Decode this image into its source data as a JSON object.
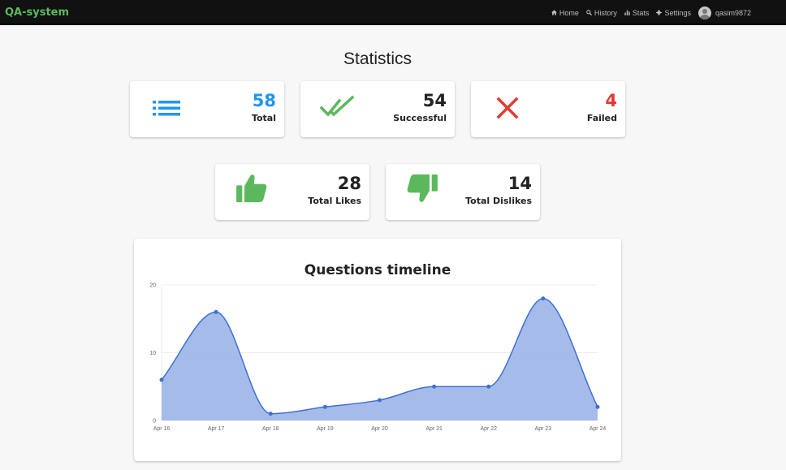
{
  "app": {
    "brand": "QA-system"
  },
  "nav": {
    "home": "Home",
    "history": "History",
    "stats": "Stats",
    "settings": "Settings",
    "username": "qasim9872"
  },
  "page": {
    "title": "Statistics"
  },
  "stats": {
    "total": {
      "value": "58",
      "label": "Total",
      "color": "#2196f3",
      "icon": "list-icon"
    },
    "successful": {
      "value": "54",
      "label": "Successful",
      "color": "#222222",
      "icon": "double-check-icon"
    },
    "failed": {
      "value": "4",
      "label": "Failed",
      "color": "#e53935",
      "icon": "cross-icon"
    },
    "likes": {
      "value": "28",
      "label": "Total Likes",
      "color": "#222222",
      "icon": "thumbs-up-icon"
    },
    "dislikes": {
      "value": "14",
      "label": "Total Dislikes",
      "color": "#222222",
      "icon": "thumbs-down-icon"
    }
  },
  "colors": {
    "success_green": "#5cb85c",
    "fail_red": "#e53935",
    "info_blue": "#2196f3",
    "series_fill": "#a0b8ea",
    "series_line": "#3f6fd1"
  },
  "chart_data": {
    "type": "area",
    "title": "Questions timeline",
    "x": [
      "Apr 16",
      "Apr 17",
      "Apr 18",
      "Apr 19",
      "Apr 20",
      "Apr 21",
      "Apr 22",
      "Apr 23",
      "Apr 24"
    ],
    "values": [
      6,
      16,
      1,
      2,
      3,
      5,
      5,
      18,
      2
    ],
    "ylim": [
      0,
      20
    ],
    "yticks": [
      0,
      10,
      20
    ],
    "grid": true,
    "legend": "none",
    "xlabel": "",
    "ylabel": ""
  }
}
